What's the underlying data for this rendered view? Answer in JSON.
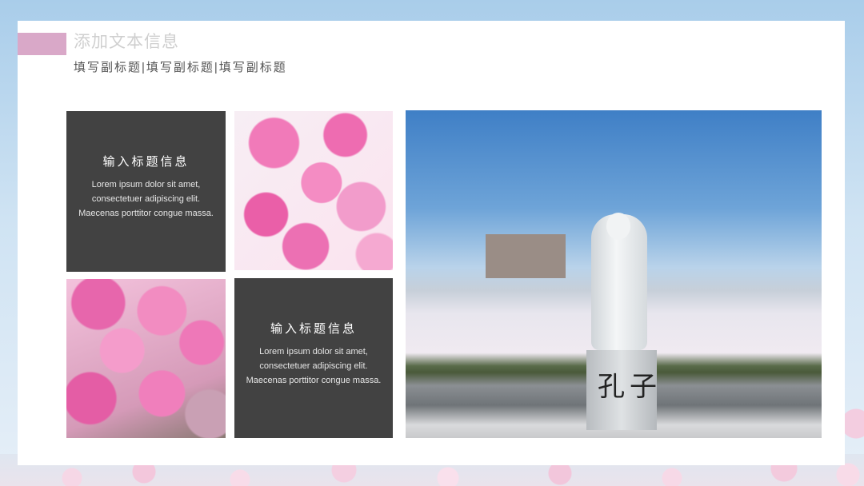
{
  "slide": {
    "title": "添加文本信息",
    "subtitle": "填写副标题|填写副标题|填写副标题"
  },
  "boxes": [
    {
      "heading": "输入标题信息",
      "body": "Lorem ipsum dolor sit amet, consectetuer adipiscing elit. Maecenas porttitor congue massa."
    },
    {
      "heading": "输入标题信息",
      "body": "Lorem ipsum dolor sit amet, consectetuer adipiscing elit. Maecenas porttitor congue massa."
    }
  ],
  "colors": {
    "accent": "#d9a8c8",
    "dark_box": "#424242",
    "card": "#ffffff",
    "sky_background": "#a9cdea"
  }
}
